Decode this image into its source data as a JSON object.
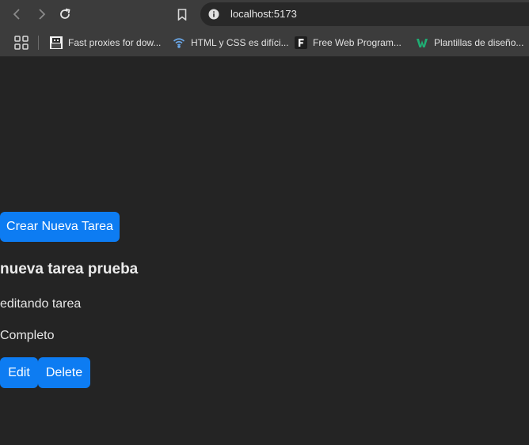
{
  "browser": {
    "url": "localhost:5173",
    "bookmarks": [
      {
        "label": "Fast proxies for dow...",
        "icon": "pixel-avatar-icon"
      },
      {
        "label": "HTML y CSS es difíci...",
        "icon": "wifi-signal-icon"
      },
      {
        "label": "Free Web Program...",
        "icon": "f-letter-icon"
      },
      {
        "label": "Plantillas de diseño...",
        "icon": "w-logo-icon"
      }
    ]
  },
  "app": {
    "create_button": "Crear Nueva Tarea",
    "task": {
      "title": "nueva tarea prueba",
      "description": "editando tarea",
      "status": "Completo"
    },
    "edit_button": "Edit",
    "delete_button": "Delete"
  },
  "colors": {
    "page_background": "#242424",
    "button_blue": "#0d7cf2",
    "chrome_toolbar": "#3c3c3c"
  }
}
